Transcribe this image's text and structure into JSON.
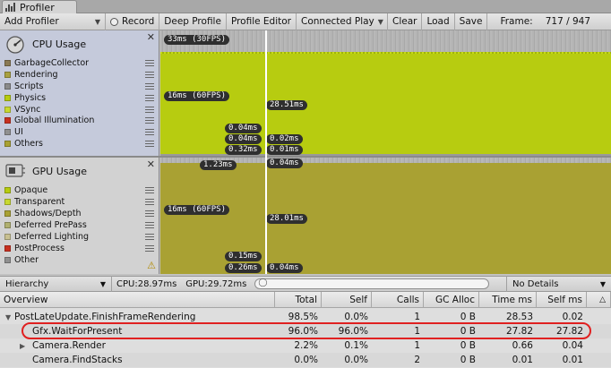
{
  "window": {
    "tab_title": "Profiler"
  },
  "toolbar": {
    "add_profiler": "Add Profiler",
    "record": "Record",
    "deep_profile": "Deep Profile",
    "profile_editor": "Profile Editor",
    "connected": "Connected Play",
    "clear": "Clear",
    "load": "Load",
    "save": "Save",
    "frame_label": "Frame:",
    "frame_value": "717 / 947"
  },
  "cpu": {
    "title": "CPU Usage",
    "legend": [
      {
        "label": "GarbageCollector",
        "color": "#8a7a54"
      },
      {
        "label": "Rendering",
        "color": "#a8a040"
      },
      {
        "label": "Scripts",
        "color": "#8a8a8a"
      },
      {
        "label": "Physics",
        "color": "#b7cc10"
      },
      {
        "label": "VSync",
        "color": "#c8d830"
      },
      {
        "label": "Global Illumination",
        "color": "#c83020"
      },
      {
        "label": "UI",
        "color": "#909090"
      },
      {
        "label": "Others",
        "color": "#a9a133"
      }
    ],
    "markers": {
      "top": "33ms (30FPS)",
      "mid": "16ms (60FPS)",
      "sel": "28.51ms",
      "v1": "0.04ms",
      "v2": "0.04ms",
      "v3": "0.02ms",
      "v4": "0.32ms",
      "v5": "0.01ms"
    }
  },
  "gpu": {
    "title": "GPU Usage",
    "legend": [
      {
        "label": "Opaque",
        "color": "#b7cc10"
      },
      {
        "label": "Transparent",
        "color": "#c8d830"
      },
      {
        "label": "Shadows/Depth",
        "color": "#a9a133"
      },
      {
        "label": "Deferred PrePass",
        "color": "#b0b070"
      },
      {
        "label": "Deferred Lighting",
        "color": "#c8c090"
      },
      {
        "label": "PostProcess",
        "color": "#c83020"
      },
      {
        "label": "Other",
        "color": "#909090"
      }
    ],
    "markers": {
      "top": "1.23ms",
      "top2": "0.04ms",
      "mid": "16ms (60FPS)",
      "sel": "28.01ms",
      "v1": "0.15ms",
      "v2": "0.26ms",
      "v3": "0.04ms"
    }
  },
  "hierarchy": {
    "mode": "Hierarchy",
    "cpu": "CPU:28.97ms",
    "gpu": "GPU:29.72ms",
    "details": "No Details"
  },
  "table": {
    "columns": [
      "Overview",
      "Total",
      "Self",
      "Calls",
      "GC Alloc",
      "Time ms",
      "Self ms"
    ],
    "rows": [
      {
        "name": "PostLateUpdate.FinishFrameRendering",
        "total": "98.5%",
        "self": "0.0%",
        "calls": "1",
        "gc": "0 B",
        "time": "28.53",
        "selfms": "0.02"
      },
      {
        "name": "Gfx.WaitForPresent",
        "total": "96.0%",
        "self": "96.0%",
        "calls": "1",
        "gc": "0 B",
        "time": "27.82",
        "selfms": "27.82"
      },
      {
        "name": "Camera.Render",
        "total": "2.2%",
        "self": "0.1%",
        "calls": "1",
        "gc": "0 B",
        "time": "0.66",
        "selfms": "0.04"
      },
      {
        "name": "Camera.FindStacks",
        "total": "0.0%",
        "self": "0.0%",
        "calls": "2",
        "gc": "0 B",
        "time": "0.01",
        "selfms": "0.01"
      }
    ]
  }
}
